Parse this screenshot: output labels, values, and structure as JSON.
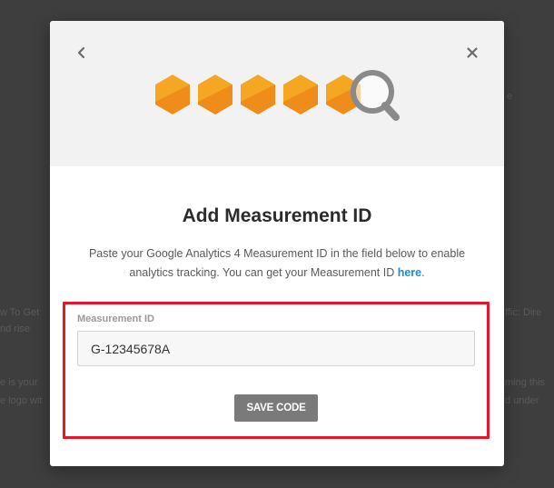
{
  "background": {
    "snippets": [
      "w To Get",
      "ffic: Dire",
      "e",
      "nd rise",
      "e is your",
      "ming this",
      "e logo wit",
      "d under"
    ]
  },
  "modal": {
    "title": "Add Measurement ID",
    "description_before_link": "Paste your Google Analytics 4 Measurement ID in the field below to enable analytics tracking. You can get your Measurement ID ",
    "link_text": "here",
    "description_after_link": ".",
    "field": {
      "label": "Measurement ID",
      "value": "G-12345678A"
    },
    "save_button_label": "SAVE CODE"
  },
  "colors": {
    "overlay": "#3e3e3e",
    "header_bg": "#f2f2f2",
    "hexagon": "#f5a623",
    "hexagon_shade": "#f08c1a",
    "magnifier": "#8a8a8a",
    "link": "#1a8fd6",
    "highlight_border": "#e8162b",
    "save_button": "#7a7a7a"
  },
  "icons": {
    "back": "chevron-left-icon",
    "close": "close-icon",
    "hero": "hexagons-magnifier-icon"
  }
}
